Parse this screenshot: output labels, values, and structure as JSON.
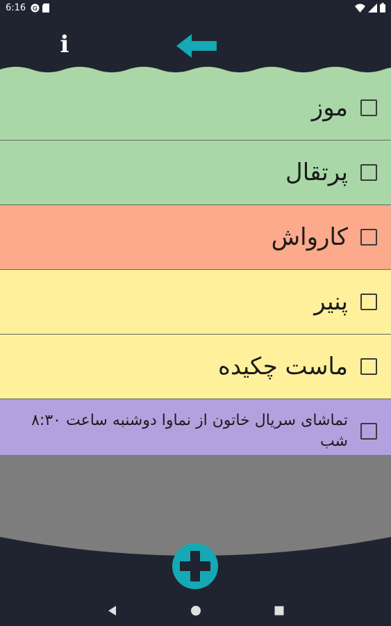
{
  "status_bar": {
    "time": "6:16",
    "left_icons": [
      "google-icon",
      "sd-card-icon"
    ],
    "right_icons": [
      "wifi-icon",
      "signal-icon",
      "battery-icon"
    ]
  },
  "top_bar": {
    "info_label": "i",
    "back_icon": "arrow-left-icon",
    "accent_color": "#14a9b5"
  },
  "items": [
    {
      "text": "موز",
      "color": "#a9d7a8",
      "checked": false
    },
    {
      "text": "پرتقال",
      "color": "#a9d7a8",
      "checked": false
    },
    {
      "text": "کارواش",
      "color": "#fca98c",
      "checked": false
    },
    {
      "text": "پنیر",
      "color": "#fff19c",
      "checked": false
    },
    {
      "text": "ماست چکیده",
      "color": "#fff19c",
      "checked": false
    },
    {
      "text": "تماشای سریال خاتون از نماوا دوشنبه ساعت ۸:۳۰ شب",
      "color": "#b3a1df",
      "checked": false
    }
  ],
  "colors": {
    "background": "#1f2430",
    "empty_area": "#7d7d7d",
    "add_button": "#14a9b5"
  },
  "fab_icon": "plus-icon",
  "nav_bar": {
    "icons": [
      "back-triangle-icon",
      "home-circle-icon",
      "recents-square-icon"
    ]
  }
}
